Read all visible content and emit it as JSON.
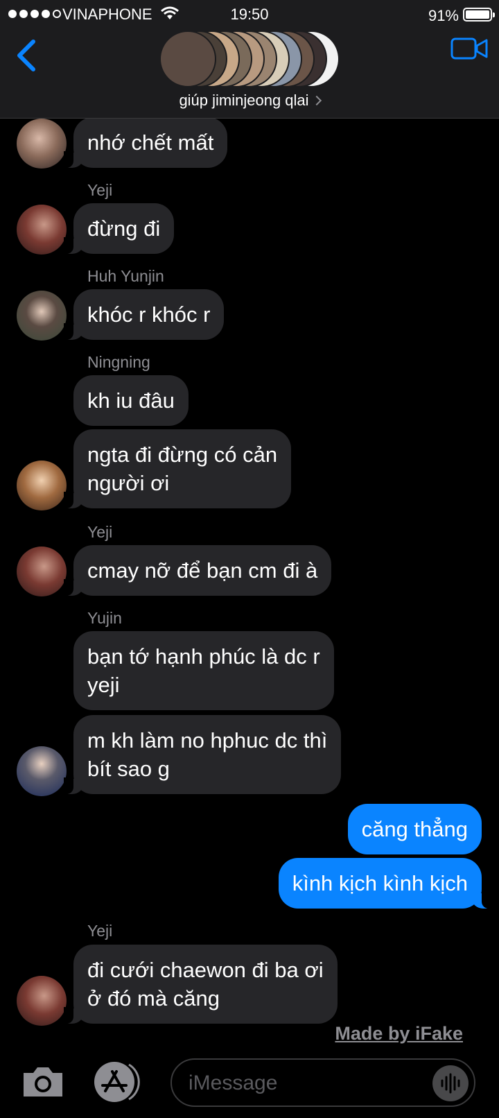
{
  "status_bar": {
    "carrier": "VINAPHONE",
    "time": "19:50",
    "battery": "91%",
    "battery_level": 0.91,
    "signal_bars": 4
  },
  "header": {
    "group_name": "giúp jiminjeong qlai",
    "back_icon": "chevron-left-icon",
    "video_icon": "video-camera-icon",
    "accent_color": "#0a84ff"
  },
  "messages": [
    {
      "sender": "",
      "text": "nhớ chết mất",
      "direction": "in"
    },
    {
      "sender": "Yeji",
      "text": "đừng đi",
      "direction": "in"
    },
    {
      "sender": "Huh Yunjin",
      "text": "khóc r khóc r",
      "direction": "in"
    },
    {
      "sender": "Ningning",
      "text": "kh iu đâu",
      "direction": "in"
    },
    {
      "sender": "",
      "text": "ngta đi đừng có cản\nngười ơi",
      "direction": "in"
    },
    {
      "sender": "Yeji",
      "text": "cmay nỡ để bạn cm đi à",
      "direction": "in"
    },
    {
      "sender": "Yujin",
      "text": "bạn tớ hạnh phúc là dc r\nyeji",
      "direction": "in"
    },
    {
      "sender": "",
      "text": "m kh làm no hphuc dc thì\nbít sao g",
      "direction": "in"
    },
    {
      "sender": "",
      "text": "căng thẳng",
      "direction": "out"
    },
    {
      "sender": "",
      "text": "kình kịch kình kịch",
      "direction": "out"
    },
    {
      "sender": "Yeji",
      "text": "đi cưới chaewon đi ba ơi\nở đó mà căng",
      "direction": "in"
    }
  ],
  "watermark": "Made by iFake",
  "input_bar": {
    "placeholder": "iMessage",
    "camera_icon": "camera-icon",
    "app_icon": "app-store-icon",
    "mic_icon": "audio-waveform-icon"
  }
}
